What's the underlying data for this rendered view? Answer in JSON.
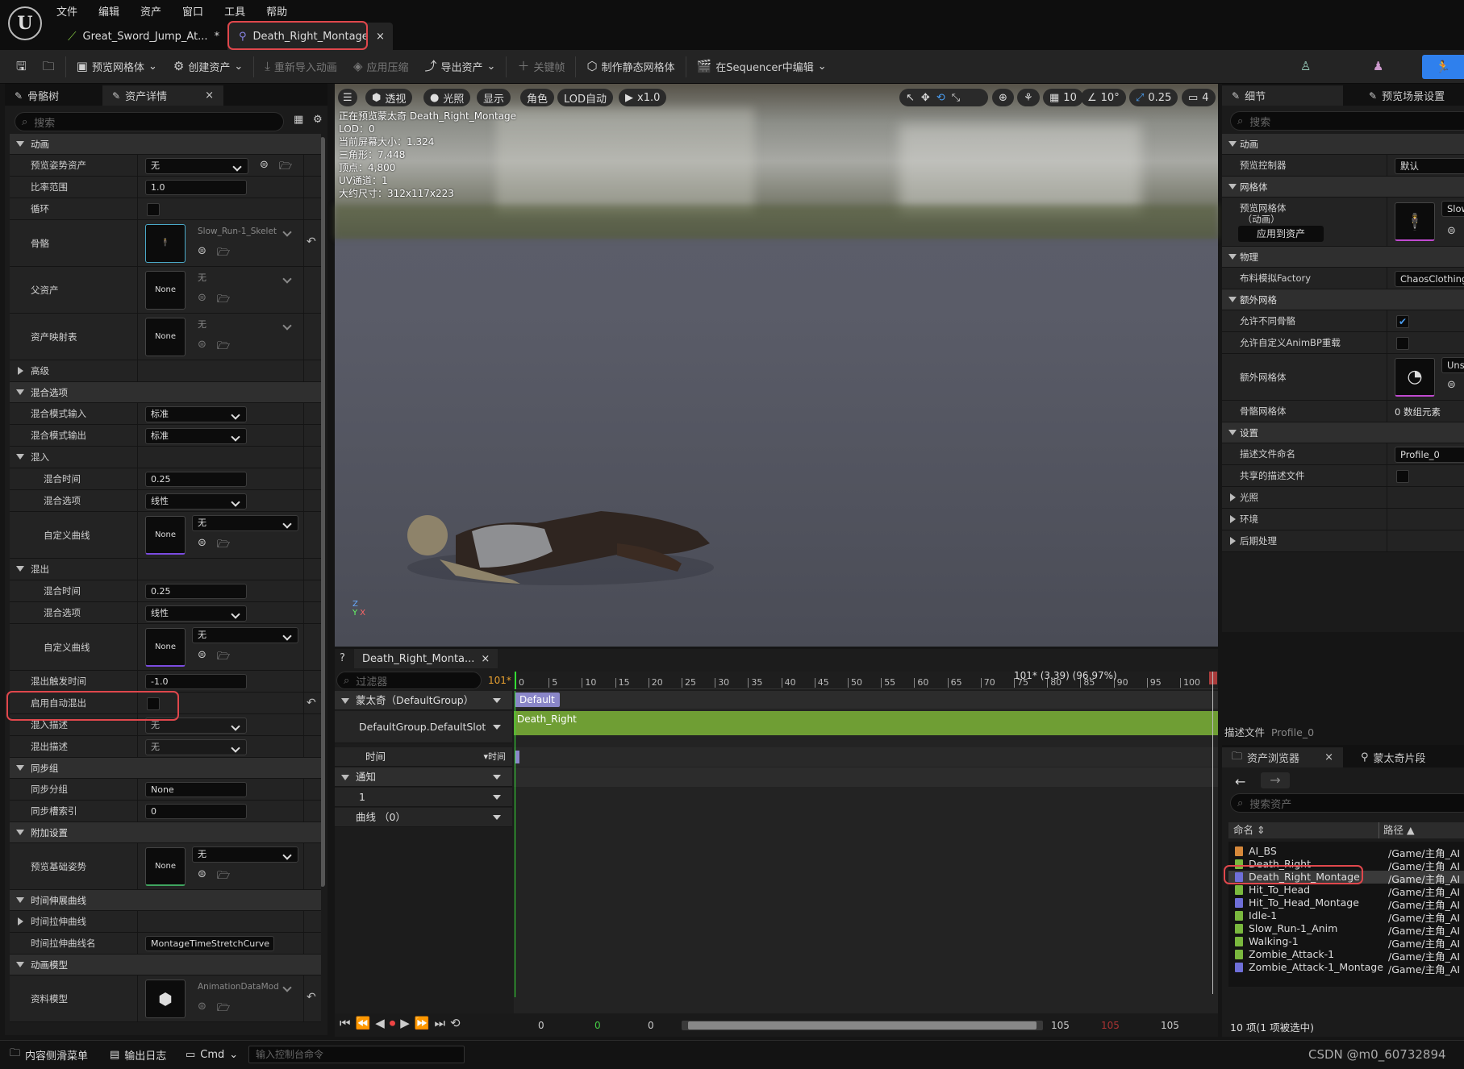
{
  "menu": [
    "文件",
    "编辑",
    "资产",
    "窗口",
    "工具",
    "帮助"
  ],
  "tabs": [
    {
      "label": "Great_Sword_Jump_At...",
      "modified": "*"
    },
    {
      "label": "Death_Right_Montage",
      "close": "×"
    }
  ],
  "toolbar": {
    "preview_mesh": "预览网格体",
    "create_asset": "创建资产",
    "reimport": "重新导入动画",
    "apply_compression": "应用压缩",
    "export_asset": "导出资产",
    "keyframe": "关键帧",
    "make_static_mesh": "制作静态网格体",
    "edit_in_sequencer": "在Sequencer中编辑"
  },
  "left_panel": {
    "tab_skeleton": "骨骼树",
    "tab_details": "资产详情",
    "search_placeholder": "搜索",
    "animation_section": "动画",
    "preview_pose_asset": "预览姿势资产",
    "preview_pose_value": "无",
    "rate_scale": "比率范围",
    "rate_scale_value": "1.0",
    "loop": "循环",
    "skeleton": "骨骼",
    "skeleton_value": "Slow_Run-1_Skelet",
    "parent_asset": "父资产",
    "parent_asset_thumb": "None",
    "parent_asset_value": "无",
    "asset_mapping": "资产映射表",
    "asset_mapping_thumb": "None",
    "asset_mapping_value": "无",
    "advanced": "高级",
    "blend_options": "混合选项",
    "blend_mode_in": "混合模式输入",
    "blend_mode_in_value": "标准",
    "blend_mode_out": "混合模式输出",
    "blend_mode_out_value": "标准",
    "blend_in": "混入",
    "blend_time": "混合时间",
    "blend_in_time_value": "0.25",
    "blend_option": "混合选项",
    "blend_in_option_value": "线性",
    "custom_curve": "自定义曲线",
    "blend_in_curve_thumb": "None",
    "blend_in_curve_value": "无",
    "blend_out": "混出",
    "blend_out_time_value": "0.25",
    "blend_out_option_value": "线性",
    "blend_out_curve_thumb": "None",
    "blend_out_curve_value": "无",
    "blend_out_trigger": "混出触发时间",
    "blend_out_trigger_value": "-1.0",
    "enable_auto_blend_out": "启用自动混出",
    "blend_in_profile": "混入描述",
    "blend_in_profile_value": "无",
    "blend_out_profile": "混出描述",
    "blend_out_profile_value": "无",
    "sync_group_section": "同步组",
    "sync_group": "同步分组",
    "sync_group_value": "None",
    "sync_slot_index": "同步槽索引",
    "sync_slot_index_value": "0",
    "additive_settings": "附加设置",
    "preview_base_pose": "预览基础姿势",
    "preview_base_thumb": "None",
    "preview_base_value": "无",
    "time_stretch_curve_section": "时间伸展曲线",
    "time_stretch_curve": "时间拉伸曲线",
    "time_stretch_curve_name": "时间拉伸曲线名",
    "time_stretch_curve_name_value": "MontageTimeStretchCurve",
    "anim_model_section": "动画模型",
    "data_model": "资料模型",
    "data_model_value": "AnimationDataMod"
  },
  "viewport": {
    "perspective": "透视",
    "lighting": "光照",
    "show": "显示",
    "character": "角色",
    "lod": "LOD自动",
    "speed": "x1.0",
    "grid": "10",
    "angle": "10°",
    "scale": "0.25",
    "camera": "4",
    "stats": [
      "正在预览蒙太奇 Death_Right_Montage",
      "LOD：0",
      "当前屏幕大小：1.324",
      "三角形：7,448",
      "顶点：4,800",
      "UV通道：1",
      "大约尺寸：312x117x223"
    ]
  },
  "sequencer": {
    "tab": "Death_Right_Monta...",
    "filter_placeholder": "过滤器",
    "frame": "101*",
    "time_readout": "101* (3.39) (96.97%)",
    "montage_group": "蒙太奇（DefaultGroup）",
    "slot": "DefaultGroup.DefaultSlot",
    "time_row": "时间",
    "time_dropdown": "时间",
    "notifies": "通知",
    "notify_track": "1",
    "curves": "曲线 （0）",
    "section_label": "Default",
    "clip_label": "Death_Right",
    "ticks": [
      "0",
      "5",
      "10",
      "15",
      "20",
      "25",
      "30",
      "35",
      "40",
      "45",
      "50",
      "55",
      "60",
      "65",
      "70",
      "75",
      "80",
      "85",
      "90",
      "95",
      "100"
    ],
    "bottom_values": [
      "0",
      "0",
      "0",
      "105",
      "105",
      "105"
    ]
  },
  "right_panel": {
    "tab_details": "细节",
    "tab_preview": "预览场景设置",
    "search_placeholder": "搜索",
    "animation": "动画",
    "preview_controller": "预览控制器",
    "preview_controller_value": "默认",
    "mesh": "网格体",
    "preview_mesh_label": "预览网格体\n（动画）",
    "preview_mesh_line1": "预览网格体",
    "preview_mesh_line2": "（动画）",
    "apply_to_asset": "应用到资产",
    "preview_mesh_value": "Slow",
    "physics": "物理",
    "cloth_factory": "布料模拟Factory",
    "cloth_factory_value": "ChaosClothing",
    "extra_mesh": "额外网格",
    "allow_diff_skeleton": "允许不同骨骼",
    "allow_custom_animbp": "允许自定义AnimBP重载",
    "additional_meshes": "额外网格体",
    "additional_meshes_value": "Uns",
    "skeletal_meshes": "骨骼网格体",
    "skeletal_meshes_value": "0 数组元素",
    "settings": "设置",
    "profile_name": "描述文件命名",
    "profile_name_value": "Profile_0",
    "shared_profile": "共享的描述文件",
    "lighting": "光照",
    "environment": "环境",
    "post_process": "后期处理",
    "profile_footer_label": "描述文件",
    "profile_footer_value": "Profile_0"
  },
  "asset_browser": {
    "tab": "资产浏览器",
    "tab2": "蒙太奇片段",
    "search_placeholder": "搜索资产",
    "col_name": "命名",
    "col_path": "路径",
    "items": [
      {
        "name": "AI_BS",
        "path": "/Game/主角_AI",
        "color": "#d6883a"
      },
      {
        "name": "Death_Right",
        "path": "/Game/主角_AI",
        "color": "#7ab83e"
      },
      {
        "name": "Death_Right_Montage",
        "path": "/Game/主角_AI",
        "color": "#6f6fd8"
      },
      {
        "name": "Hit_To_Head",
        "path": "/Game/主角_AI",
        "color": "#7ab83e"
      },
      {
        "name": "Hit_To_Head_Montage",
        "path": "/Game/主角_AI",
        "color": "#6f6fd8"
      },
      {
        "name": "Idle-1",
        "path": "/Game/主角_AI",
        "color": "#7ab83e"
      },
      {
        "name": "Slow_Run-1_Anim",
        "path": "/Game/主角_AI",
        "color": "#7ab83e"
      },
      {
        "name": "Walking-1",
        "path": "/Game/主角_AI",
        "color": "#7ab83e"
      },
      {
        "name": "Zombie_Attack-1",
        "path": "/Game/主角_AI",
        "color": "#7ab83e"
      },
      {
        "name": "Zombie_Attack-1_Montage",
        "path": "/Game/主角_AI",
        "color": "#6f6fd8"
      }
    ],
    "footer": "10 项(1 项被选中)"
  },
  "statusbar": {
    "content_drawer": "内容侧滑菜单",
    "output_log": "输出日志",
    "cmd": "Cmd",
    "console_placeholder": "输入控制台命令",
    "watermark": "CSDN @m0_60732894"
  },
  "colors": {
    "accent": "#2f80ed",
    "highlight": "#e0474c",
    "clip": "#6f9e34",
    "section": "#8a86c8"
  }
}
